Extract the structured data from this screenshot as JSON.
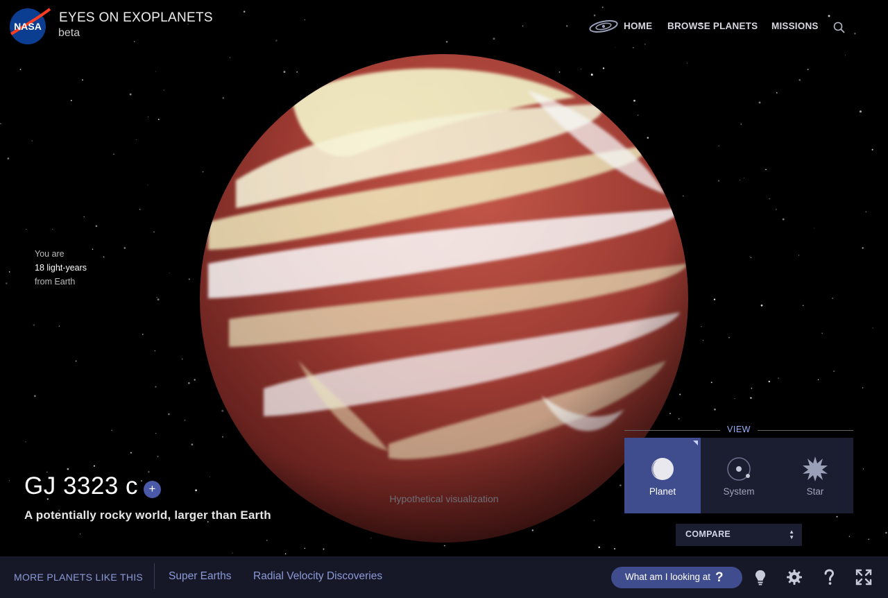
{
  "header": {
    "brand_logo_text": "NASA",
    "title": "EYES ON EXOPLANETS",
    "subtitle": "beta"
  },
  "nav": {
    "galaxy_icon": "galaxy-icon",
    "items": [
      {
        "label": "HOME"
      },
      {
        "label": "BROWSE PLANETS"
      },
      {
        "label": "MISSIONS"
      }
    ],
    "search_icon": "search-icon"
  },
  "distance": {
    "prefix": "You are",
    "value": "18 light-years",
    "suffix": "from Earth"
  },
  "planet": {
    "name": "GJ 3323 c",
    "add_symbol": "+",
    "description": "A potentially rocky world, larger than Earth",
    "visual_note": "Hypothetical visualization"
  },
  "view": {
    "label": "VIEW",
    "options": [
      {
        "label": "Planet",
        "icon": "planet-icon",
        "active": true
      },
      {
        "label": "System",
        "icon": "system-icon",
        "active": false
      },
      {
        "label": "Star",
        "icon": "star-icon",
        "active": false
      }
    ],
    "compare_label": "COMPARE",
    "compare_arrows": [
      "▲",
      "▼"
    ]
  },
  "bottombar": {
    "more_label": "MORE PLANETS LIKE THIS",
    "categories": [
      {
        "label": "Super Earths"
      },
      {
        "label": "Radial Velocity Discoveries"
      }
    ],
    "help_button": {
      "label": "What am I looking at",
      "symbol": "?"
    },
    "tools": [
      {
        "icon": "lightbulb-icon"
      },
      {
        "icon": "gear-icon"
      },
      {
        "icon": "help-icon"
      },
      {
        "icon": "fullscreen-icon"
      }
    ]
  },
  "colors": {
    "background": "#000000",
    "accent": "#3f4d8e",
    "link": "#8c9ad8",
    "bar": "#161827",
    "panel": "#1b1d30",
    "planet_base": "#9c3a32",
    "planet_cloud": "#f3efc6"
  }
}
